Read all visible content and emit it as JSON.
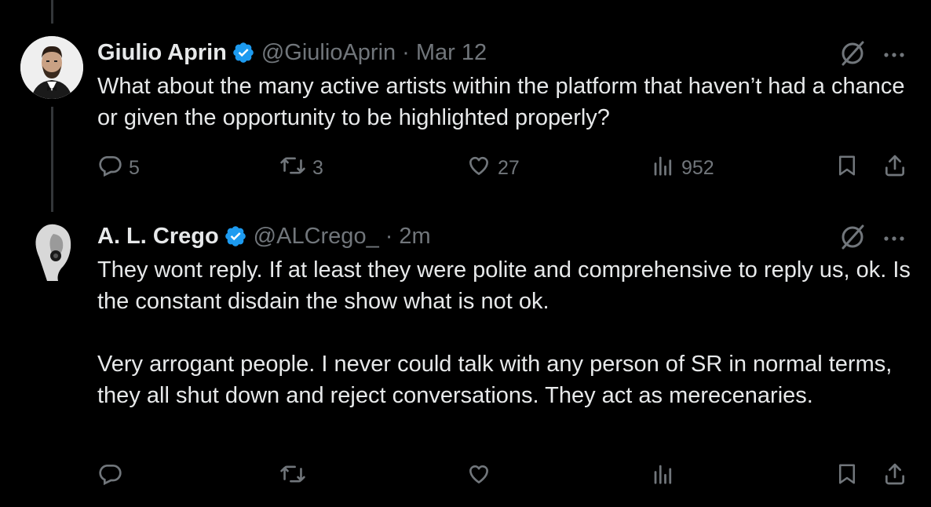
{
  "tweets": [
    {
      "name": "Giulio Aprin",
      "handle": "@GiulioAprin",
      "separator": "·",
      "time": "Mar 12",
      "paragraphs": [
        "What about the many active artists within the platform that haven’t had a chance or given the opportunity to be highlighted properly?"
      ],
      "replies": "5",
      "reposts": "3",
      "likes": "27",
      "views": "952",
      "icons": [
        "grok-icon",
        "more-icon",
        "reply-icon",
        "repost-icon",
        "like-icon",
        "views-icon",
        "bookmark-icon",
        "share-icon"
      ]
    },
    {
      "name": "A. L. Crego",
      "handle": "@ALCrego_",
      "separator": "·",
      "time": "2m",
      "paragraphs": [
        "They wont reply. If at least they were polite and comprehensive to reply us, ok. Is the constant disdain the show what is not ok.",
        "Very arrogant people. I never could talk with any person of SR in normal terms, they all shut down and reject conversations. They act as merecenaries."
      ],
      "replies": "",
      "reposts": "",
      "likes": "",
      "views": "",
      "icons": [
        "grok-icon",
        "more-icon",
        "reply-icon",
        "repost-icon",
        "like-icon",
        "views-icon",
        "bookmark-icon",
        "share-icon"
      ]
    }
  ],
  "colors": {
    "background": "#000000",
    "text": "#e7e9ea",
    "secondary": "#71767b",
    "verified": "#1d9bf0",
    "thread_line": "#333639"
  }
}
